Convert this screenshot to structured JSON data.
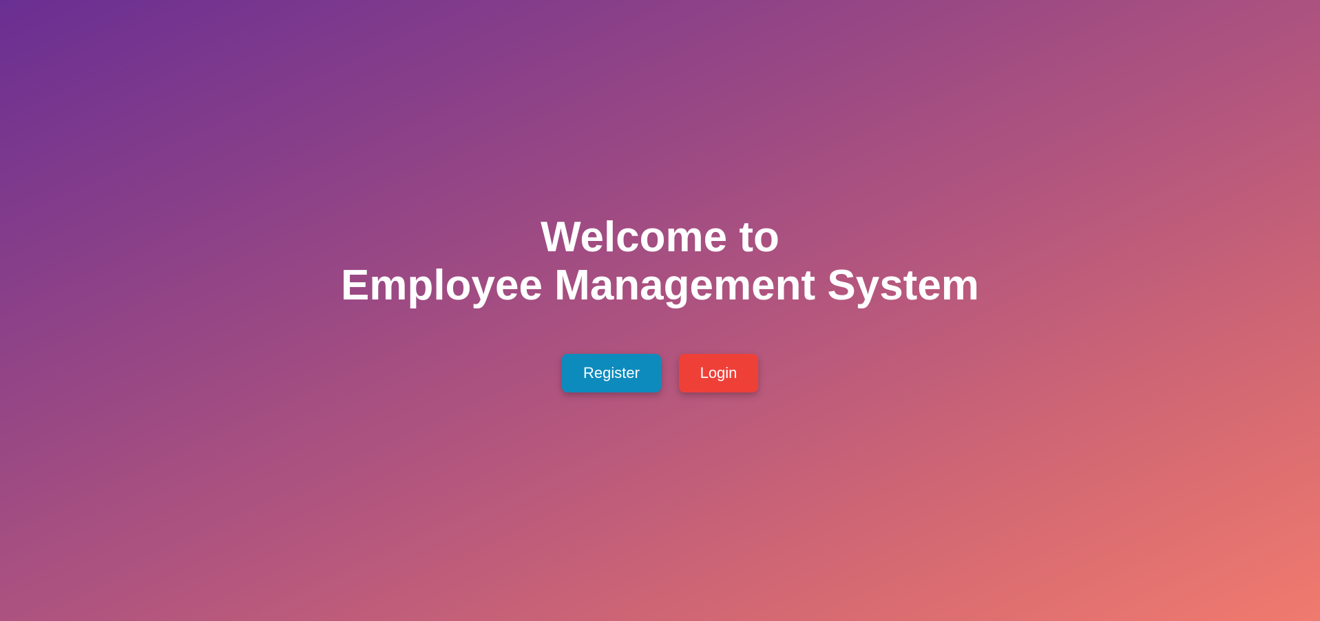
{
  "hero": {
    "title_line1": "Welcome to",
    "title_line2": "Employee Management System"
  },
  "actions": {
    "register_label": "Register",
    "login_label": "Login"
  },
  "colors": {
    "register_button": "#0e8bbd",
    "login_button": "#ef4038",
    "gradient_start": "#6a2f93",
    "gradient_end": "#f07a6e"
  }
}
